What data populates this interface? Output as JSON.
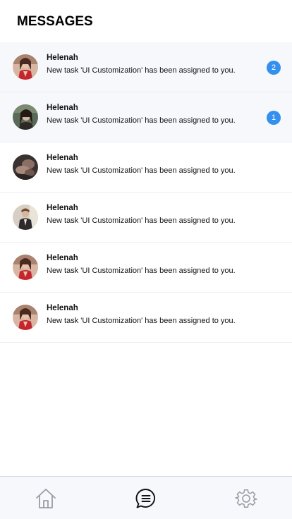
{
  "header": {
    "title": "MESSAGES"
  },
  "messages": [
    {
      "sender": "Helenah",
      "text": "New task 'UI Customization' has been assigned to you.",
      "badge": "2",
      "unread": true,
      "avatar": "woman-red-dress-avatar"
    },
    {
      "sender": "Helenah",
      "text": "New task 'UI Customization' has been assigned to you.",
      "badge": "1",
      "unread": true,
      "avatar": "woman-dark-hair-avatar"
    },
    {
      "sender": "Helenah",
      "text": "New task 'UI Customization' has been assigned to you.",
      "badge": "",
      "unread": false,
      "avatar": "dark-portrait-avatar"
    },
    {
      "sender": "Helenah",
      "text": "New task 'UI Customization' has been assigned to you.",
      "badge": "",
      "unread": false,
      "avatar": "man-suit-avatar"
    },
    {
      "sender": "Helenah",
      "text": "New task 'UI Customization' has been assigned to you.",
      "badge": "",
      "unread": false,
      "avatar": "woman-red-dress-avatar"
    },
    {
      "sender": "Helenah",
      "text": "New task 'UI Customization' has been assigned to you.",
      "badge": "",
      "unread": false,
      "avatar": "woman-red-dress-avatar"
    }
  ],
  "tabbar": {
    "items": [
      {
        "icon": "home-icon",
        "active": false
      },
      {
        "icon": "chat-icon",
        "active": true
      },
      {
        "icon": "gear-icon",
        "active": false
      }
    ]
  },
  "colors": {
    "accent": "#3390ee",
    "unread_bg": "#f7f8fc",
    "icon_inactive": "#9a9ca6",
    "icon_active": "#111111"
  }
}
